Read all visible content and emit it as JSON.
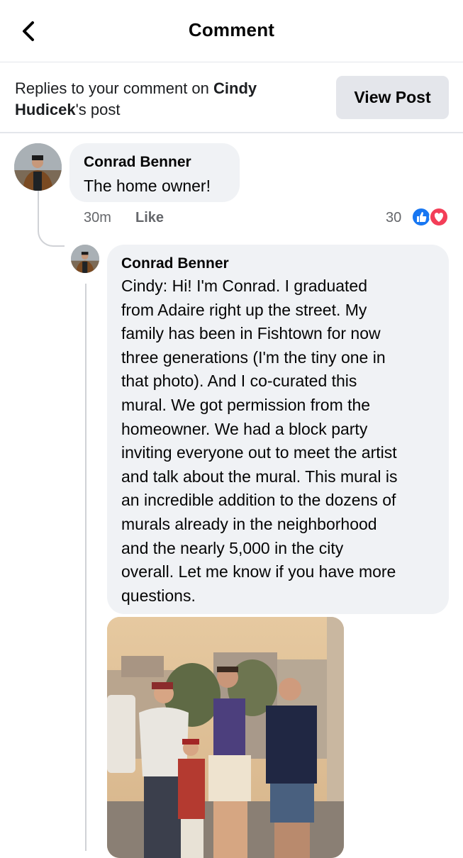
{
  "header": {
    "title": "Comment"
  },
  "context": {
    "prefix": "Replies to your comment on ",
    "post_owner": "Cindy Hudicek",
    "suffix": "'s post",
    "view_post_label": "View Post"
  },
  "comment": {
    "author": "Conrad Benner",
    "text": "The home owner!",
    "time": "30m",
    "like_label": "Like",
    "reaction_count": "30",
    "reactions": [
      "like",
      "love"
    ]
  },
  "reply": {
    "author": "Conrad Benner",
    "lines": [
      "Cindy: Hi! I'm Conrad. I graduated",
      "from Adaire right up the street. My",
      "family has been in Fishtown for now",
      "three generations (I'm the tiny one in",
      "that photo). And I co-curated this",
      "mural. We got permission from the",
      "homeowner. We had a block party",
      "inviting everyone out to meet the artist",
      "and talk about the mural. This mural is",
      "an incredible addition to the dozens of",
      "murals already in the neighborhood",
      "and the nearly 5,000 in the city",
      "overall. Let me know if you have more",
      "questions."
    ]
  },
  "colors": {
    "like_blue": "#1877f2",
    "love_red": "#f33e58",
    "bubble_bg": "#f0f2f5",
    "button_bg": "#e4e6eb"
  }
}
